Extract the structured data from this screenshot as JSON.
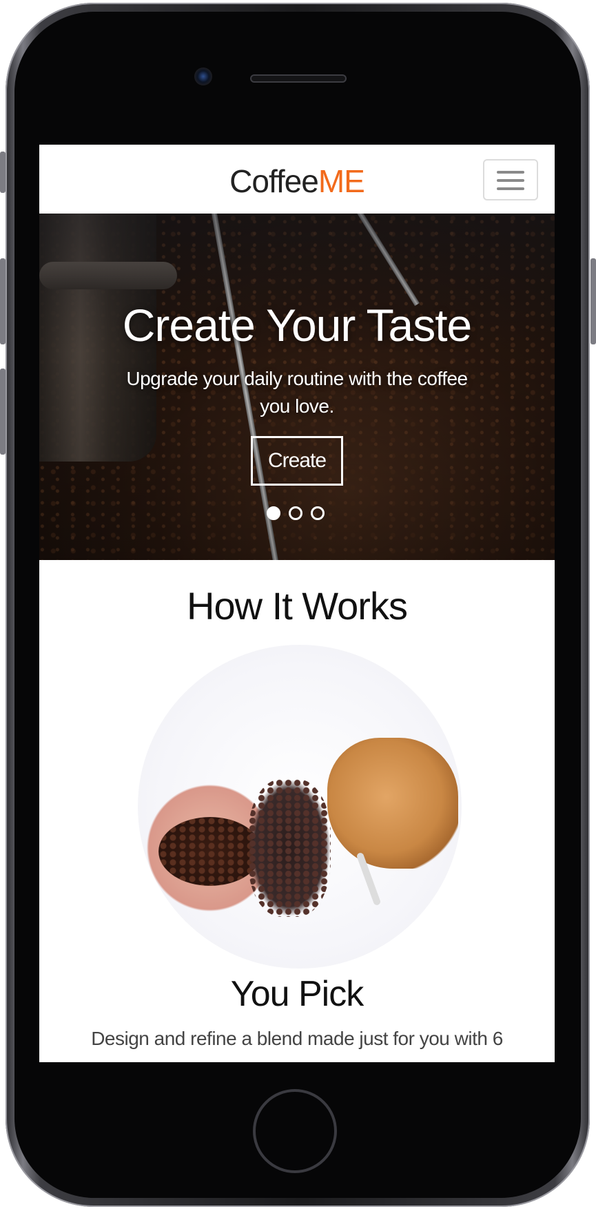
{
  "navbar": {
    "logo_part1": "Coffee",
    "logo_part2": "ME",
    "menu_icon": "hamburger-menu-icon"
  },
  "hero": {
    "title": "Create Your Taste",
    "subtitle": "Upgrade your daily routine with the coffee you love.",
    "button_label": "Create",
    "slide_count": 3,
    "active_slide": 1
  },
  "how_it_works": {
    "title": "How It Works",
    "step_title": "You Pick",
    "step_text": "Design and refine a blend made just for you with 6"
  },
  "colors": {
    "brand_accent": "#f26a1b",
    "text_dark": "#111111"
  }
}
